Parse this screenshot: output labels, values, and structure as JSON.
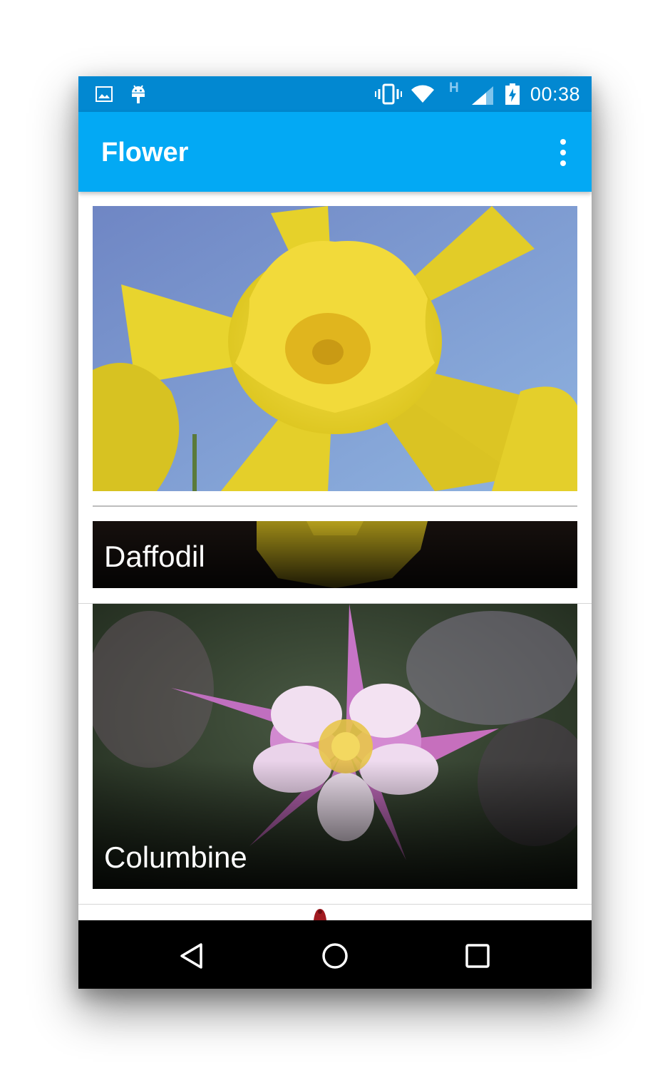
{
  "status_bar": {
    "time": "00:38",
    "network_label": "H",
    "icons": [
      "image-icon",
      "android-icon",
      "vibrate-icon",
      "wifi-icon",
      "signal-icon",
      "battery-charging-icon"
    ]
  },
  "app_bar": {
    "title": "Flower",
    "menu_icon": "overflow-menu-icon"
  },
  "flowers": [
    {
      "name": "Daffodil",
      "image": "daffodil-photo"
    },
    {
      "name": "Columbine",
      "image": "columbine-photo"
    }
  ],
  "nav_bar": {
    "icons": [
      "back-icon",
      "home-icon",
      "recents-icon"
    ]
  },
  "colors": {
    "status_bar": "#0288d1",
    "app_bar": "#03a9f4",
    "nav_bar": "#000000"
  }
}
